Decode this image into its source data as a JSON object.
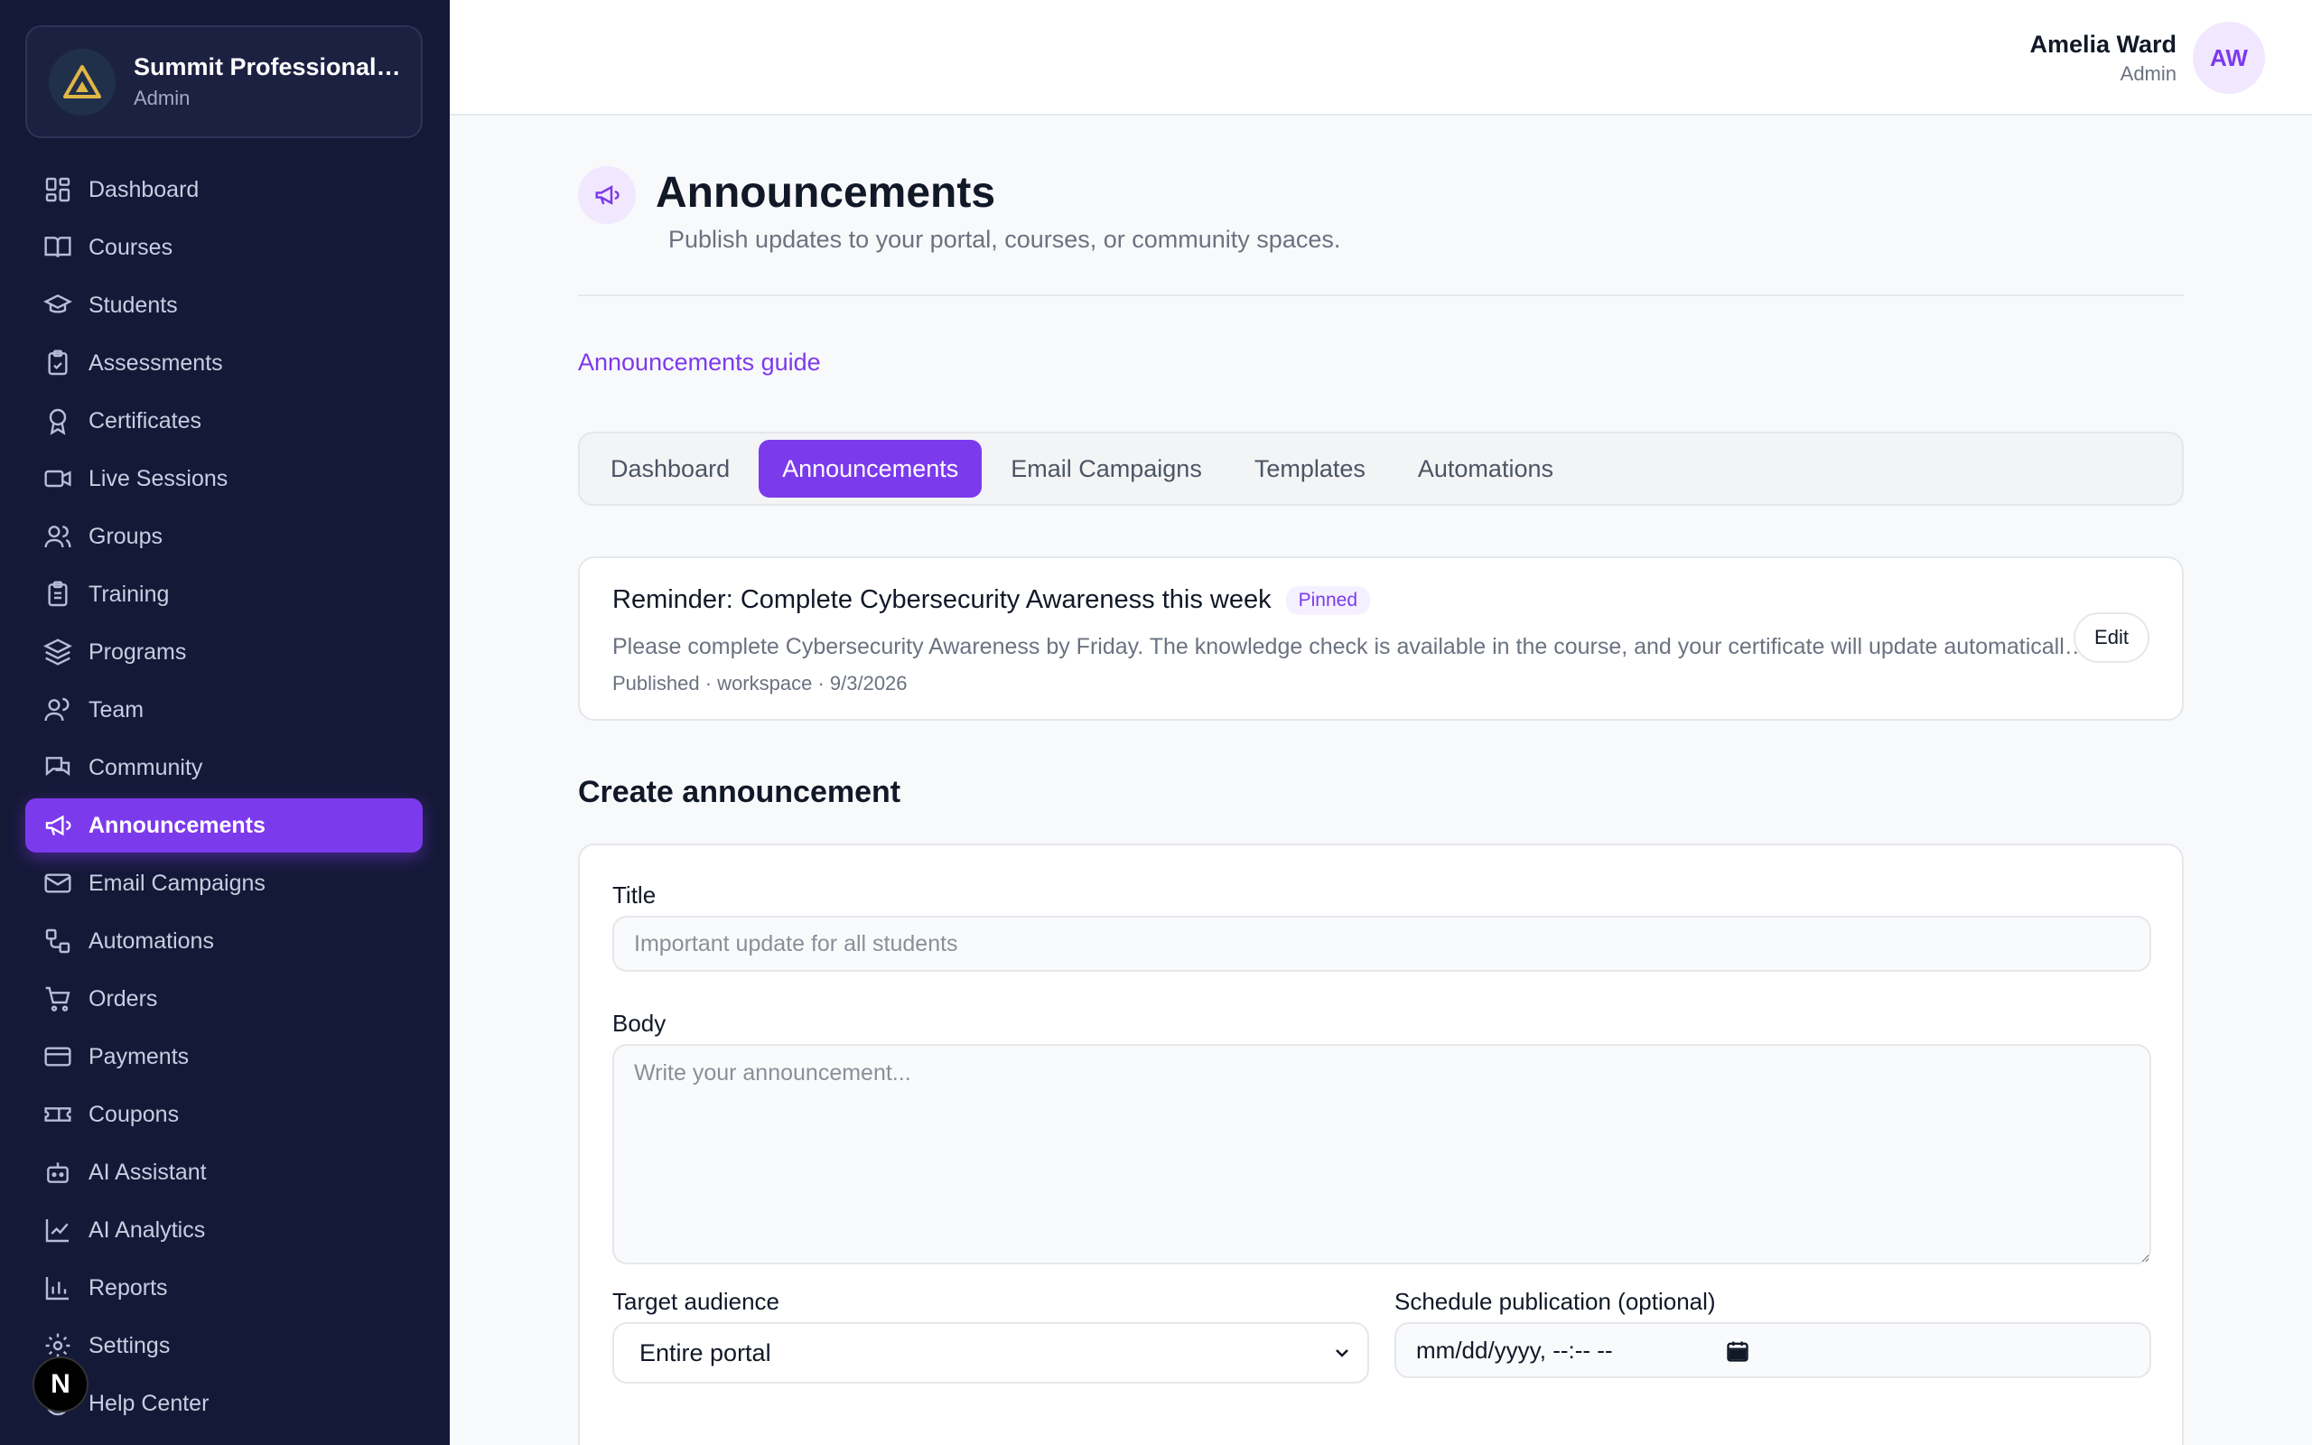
{
  "org": {
    "name": "Summit Professional Academy",
    "role": "Admin"
  },
  "sidebar": {
    "items": [
      {
        "label": "Dashboard",
        "icon": "dashboard-icon"
      },
      {
        "label": "Courses",
        "icon": "book-icon"
      },
      {
        "label": "Students",
        "icon": "graduation-cap-icon"
      },
      {
        "label": "Assessments",
        "icon": "clipboard-check-icon"
      },
      {
        "label": "Certificates",
        "icon": "award-icon"
      },
      {
        "label": "Live Sessions",
        "icon": "video-icon"
      },
      {
        "label": "Groups",
        "icon": "users-icon"
      },
      {
        "label": "Training",
        "icon": "clipboard-list-icon"
      },
      {
        "label": "Programs",
        "icon": "layers-icon"
      },
      {
        "label": "Team",
        "icon": "team-icon"
      },
      {
        "label": "Community",
        "icon": "chat-icon"
      },
      {
        "label": "Announcements",
        "icon": "megaphone-icon",
        "active": true
      },
      {
        "label": "Email Campaigns",
        "icon": "mail-icon"
      },
      {
        "label": "Automations",
        "icon": "workflow-icon"
      },
      {
        "label": "Orders",
        "icon": "cart-icon"
      },
      {
        "label": "Payments",
        "icon": "credit-card-icon"
      },
      {
        "label": "Coupons",
        "icon": "ticket-icon"
      },
      {
        "label": "AI Assistant",
        "icon": "bot-icon"
      },
      {
        "label": "AI Analytics",
        "icon": "trend-icon"
      },
      {
        "label": "Reports",
        "icon": "bar-chart-icon"
      },
      {
        "label": "Settings",
        "icon": "gear-icon"
      },
      {
        "label": "Help Center",
        "icon": "help-icon"
      }
    ],
    "badge": "N"
  },
  "user": {
    "name": "Amelia Ward",
    "role": "Admin",
    "initials": "AW"
  },
  "page": {
    "title": "Announcements",
    "subtitle": "Publish updates to your portal, courses, or community spaces.",
    "guide_link": "Announcements guide"
  },
  "tabs": [
    {
      "label": "Dashboard"
    },
    {
      "label": "Announcements",
      "active": true
    },
    {
      "label": "Email Campaigns"
    },
    {
      "label": "Templates"
    },
    {
      "label": "Automations"
    }
  ],
  "announcement": {
    "title": "Reminder: Complete Cybersecurity Awareness this week",
    "pill": "Pinned",
    "body": "Please complete Cybersecurity Awareness by Friday. The knowledge check is available in the course, and your certificate will update automatically once you pass.",
    "meta": "Published · workspace · 9/3/2026",
    "edit_label": "Edit"
  },
  "form": {
    "section_title": "Create announcement",
    "title_label": "Title",
    "title_placeholder": "Important update for all students",
    "body_label": "Body",
    "body_placeholder": "Write your announcement...",
    "audience_label": "Target audience",
    "audience_value": "Entire portal",
    "schedule_label": "Schedule publication (optional)",
    "schedule_placeholder": "mm/dd/yyyy, --:-- --"
  },
  "colors": {
    "accent": "#7c3aed",
    "sidebar": "#151938"
  }
}
